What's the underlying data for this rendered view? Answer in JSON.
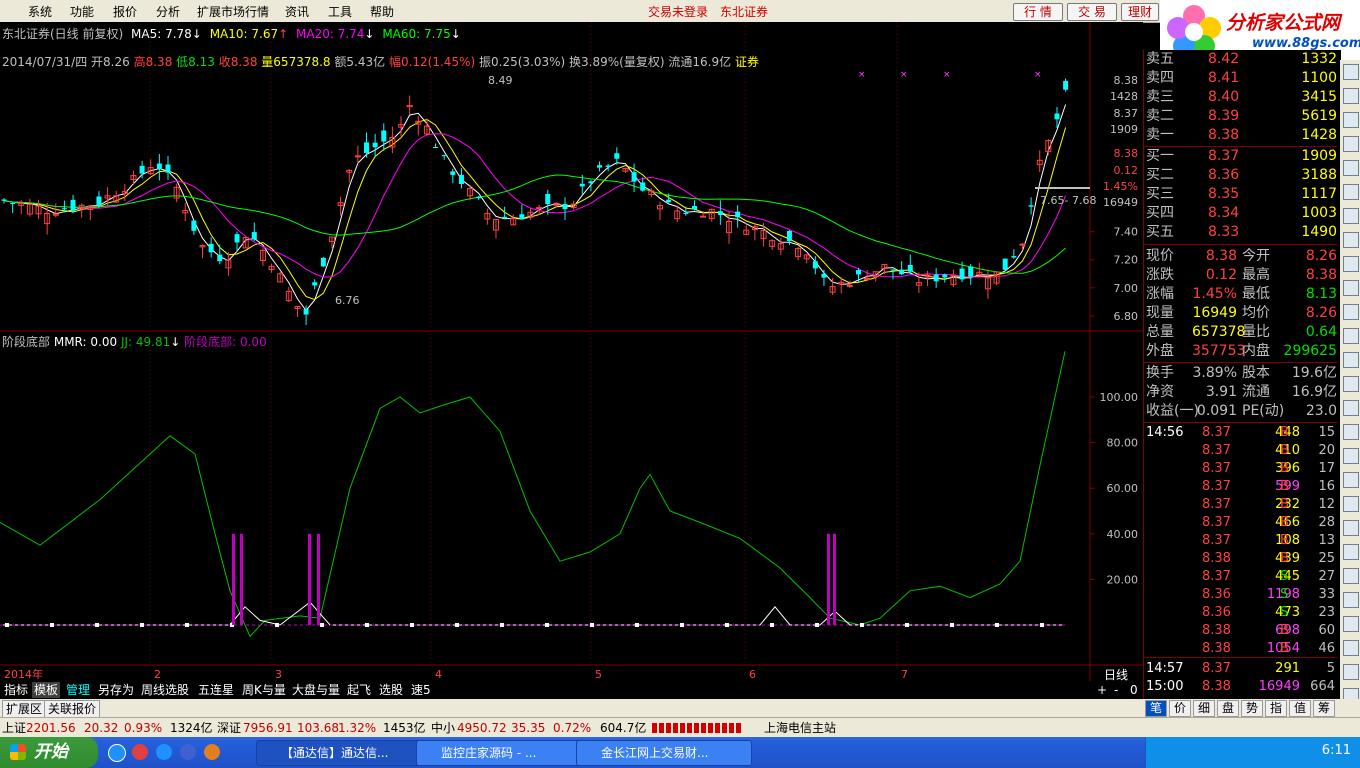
{
  "menu": {
    "items": [
      "系统",
      "功能",
      "报价",
      "分析",
      "扩展市场行情",
      "资讯",
      "工具",
      "帮助"
    ],
    "status_login": "交易未登录",
    "broker": "东北证券",
    "btn_quote": "行 情",
    "btn_trade": "交 易",
    "btn_finance": "理财",
    "logo_text": "分析家公式网",
    "logo_url": "www.88gs.com"
  },
  "chart_header": {
    "title": "东北证券(日线 前复权)",
    "ma5": "MA5: 7.78",
    "ma10": "MA10: 7.67",
    "ma20": "MA20: 7.74",
    "ma60": "MA60: 7.75",
    "info_date": "2014/07/31/四",
    "info_open": "开8.26",
    "info_high": "高8.38",
    "info_low": "低8.13",
    "info_close": "收8.38",
    "info_vol": "量657378.8",
    "info_amt": "额5.43亿",
    "info_chg": "幅0.12(1.45%)",
    "info_amp": "振0.25(3.03%)",
    "info_turn": "换3.89%(量复权)",
    "info_float": "流通16.9亿",
    "info_tag": "证券"
  },
  "price_axis": [
    "7.40",
    "7.20",
    "7.00",
    "6.80"
  ],
  "price_side": [
    "8.38",
    "1428",
    "8.37",
    "1909",
    "8.38",
    "0.12",
    "1.45%",
    "16949"
  ],
  "annotations": {
    "high_label": "8.49",
    "low_label": "6.76",
    "cursor_label": "7.65- 7.68"
  },
  "indicator_header": {
    "name": "阶段底部",
    "mmr": "MMR: 0.00",
    "jj": "JJ: 49.81",
    "jd": "阶段底部: 0.00"
  },
  "indicator_axis": [
    "100.00",
    "80.00",
    "60.00",
    "40.00",
    "20.00"
  ],
  "time_axis": [
    "2014年",
    "2",
    "3",
    "4",
    "5",
    "6",
    "7"
  ],
  "period": "日线",
  "order_book": {
    "sell": [
      {
        "label": "卖五",
        "price": "8.42",
        "vol": "1332"
      },
      {
        "label": "卖四",
        "price": "8.41",
        "vol": "1100"
      },
      {
        "label": "卖三",
        "price": "8.40",
        "vol": "3415"
      },
      {
        "label": "卖二",
        "price": "8.39",
        "vol": "5619"
      },
      {
        "label": "卖一",
        "price": "8.38",
        "vol": "1428"
      }
    ],
    "buy": [
      {
        "label": "买一",
        "price": "8.37",
        "vol": "1909"
      },
      {
        "label": "买二",
        "price": "8.36",
        "vol": "3188"
      },
      {
        "label": "买三",
        "price": "8.35",
        "vol": "1117"
      },
      {
        "label": "买四",
        "price": "8.34",
        "vol": "1003"
      },
      {
        "label": "买五",
        "price": "8.33",
        "vol": "1490"
      }
    ]
  },
  "quote": [
    {
      "l1": "现价",
      "v1": "8.38",
      "l2": "今开",
      "v2": "8.26",
      "c1": "#ff4040",
      "c2": "#ff4040"
    },
    {
      "l1": "涨跌",
      "v1": "0.12",
      "l2": "最高",
      "v2": "8.38",
      "c1": "#ff4040",
      "c2": "#ff4040"
    },
    {
      "l1": "涨幅",
      "v1": "1.45%",
      "l2": "最低",
      "v2": "8.13",
      "c1": "#ff4040",
      "c2": "#00e000"
    },
    {
      "l1": "现量",
      "v1": "16949",
      "l2": "均价",
      "v2": "8.26",
      "c1": "#ffff00",
      "c2": "#ff4040"
    },
    {
      "l1": "总量",
      "v1": "657378",
      "l2": "量比",
      "v2": "0.64",
      "c1": "#ffff00",
      "c2": "#00e000"
    },
    {
      "l1": "外盘",
      "v1": "357753",
      "l2": "内盘",
      "v2": "299625",
      "c1": "#ff4040",
      "c2": "#00e000"
    }
  ],
  "fundamentals": [
    {
      "l1": "换手",
      "v1": "3.89%",
      "l2": "股本",
      "v2": "19.6亿"
    },
    {
      "l1": "净资",
      "v1": "3.91",
      "l2": "流通",
      "v2": "16.9亿"
    },
    {
      "l1": "收益(一)",
      "v1": "0.091",
      "l2": "PE(动)",
      "v2": "23.0"
    }
  ],
  "ticks": [
    {
      "t": "14:56",
      "p": "8.37",
      "v": "448",
      "d": "B",
      "n": "15"
    },
    {
      "t": "",
      "p": "8.37",
      "v": "410",
      "d": "B",
      "n": "20"
    },
    {
      "t": "",
      "p": "8.37",
      "v": "396",
      "d": "B",
      "n": "17"
    },
    {
      "t": "",
      "p": "8.37",
      "v": "599",
      "d": "B",
      "n": "16"
    },
    {
      "t": "",
      "p": "8.37",
      "v": "232",
      "d": "B",
      "n": "12"
    },
    {
      "t": "",
      "p": "8.37",
      "v": "466",
      "d": "B",
      "n": "28"
    },
    {
      "t": "",
      "p": "8.37",
      "v": "108",
      "d": "B",
      "n": "13"
    },
    {
      "t": "",
      "p": "8.38",
      "v": "439",
      "d": "B",
      "n": "25"
    },
    {
      "t": "",
      "p": "8.37",
      "v": "445",
      "d": "S",
      "n": "27"
    },
    {
      "t": "",
      "p": "8.36",
      "v": "1198",
      "d": "S",
      "n": "33"
    },
    {
      "t": "",
      "p": "8.36",
      "v": "473",
      "d": "S",
      "n": "23"
    },
    {
      "t": "",
      "p": "8.38",
      "v": "698",
      "d": "B",
      "n": "60"
    },
    {
      "t": "",
      "p": "8.38",
      "v": "1054",
      "d": "B",
      "n": "46"
    },
    {
      "t": "14:57",
      "p": "8.37",
      "v": "291",
      "d": "",
      "n": "5"
    },
    {
      "t": "15:00",
      "p": "8.38",
      "v": "16949",
      "d": "",
      "n": "664"
    }
  ],
  "bottom_tabs": [
    "指标",
    "模板",
    "管理",
    "另存为",
    "周线选股",
    "五连星",
    "周K与量",
    "大盘与量",
    "起飞",
    "选股",
    "速5"
  ],
  "ext_tabs": [
    "扩展区",
    "关联报价"
  ],
  "zoom_controls": [
    "+",
    "-",
    "0"
  ],
  "right_tabs": [
    "笔",
    "价",
    "细",
    "盘",
    "势",
    "指",
    "值",
    "筹"
  ],
  "status": {
    "sh_label": "上证",
    "sh_val": "2201.56",
    "sh_chg": "20.32",
    "sh_pct": "0.93%",
    "sh_amt": "1324亿",
    "sz_label": "深证",
    "sz_val": "7956.91",
    "sz_chg": "103.68",
    "sz_pct": "1.32%",
    "sz_amt": "1453亿",
    "zx_label": "中小",
    "zx_val": "4950.72",
    "zx_chg": "35.35",
    "zx_pct": "0.72%",
    "zx_amt": "604.7亿",
    "server": "上海电信主站"
  },
  "taskbar": {
    "start": "开始",
    "tasks": [
      "【通达信】通达信...",
      "监控庄家源码 - ...",
      "金长江网上交易财..."
    ],
    "clock": "6:11"
  },
  "colors": {
    "up": "#ff4040",
    "down": "#00ffff",
    "ma5": "#ffffff",
    "ma10": "#ffff00",
    "ma20": "#ff00ff",
    "ma60": "#00ff00",
    "grid": "#800000",
    "jj": "#00c000"
  }
}
